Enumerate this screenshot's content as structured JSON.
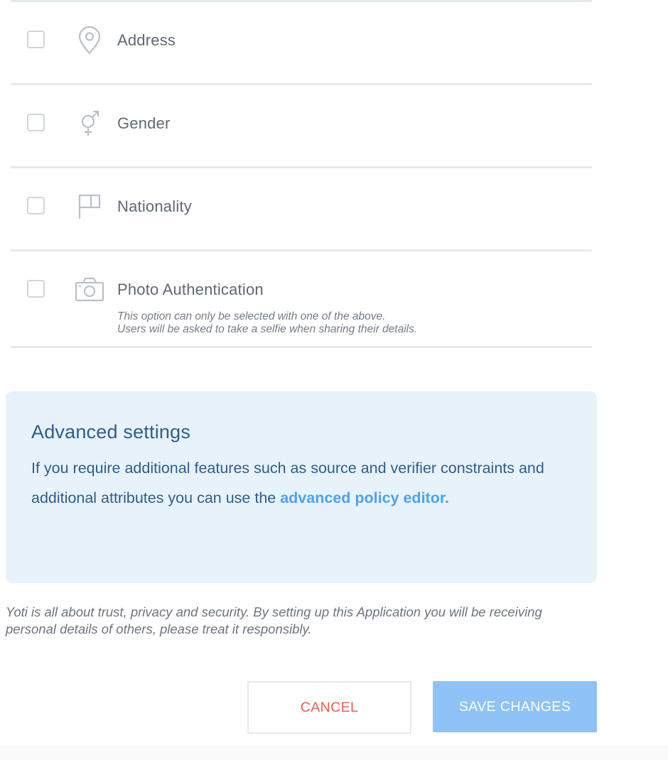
{
  "attributes": [
    {
      "icon": "location-pin-icon",
      "label": "Address",
      "checked": false
    },
    {
      "icon": "gender-icon",
      "label": "Gender",
      "checked": false
    },
    {
      "icon": "flag-icon",
      "label": "Nationality",
      "checked": false
    },
    {
      "icon": "camera-icon",
      "label": "Photo Authentication",
      "checked": false,
      "note_line1": "This option can only be selected with one of the above.",
      "note_line2": "Users will be asked to take a selfie when sharing their details."
    }
  ],
  "advanced": {
    "title": "Advanced settings",
    "text_before_link": "If you require additional features such as source and verifier constraints and additional attributes you can use the ",
    "link_text": "advanced policy editor."
  },
  "disclaimer": "Yoti is all about trust, privacy and security. By setting up this Application you will be receiving personal details of others, please treat it responsibly.",
  "buttons": {
    "cancel_label": "CANCEL",
    "save_label": "SAVE CHANGES"
  },
  "colors": {
    "cancel_text": "#e8604c",
    "save_background": "#8fc3f7",
    "advanced_background": "#e8f2fb",
    "advanced_text": "#2d5e8c",
    "link": "#4ba3f2"
  }
}
